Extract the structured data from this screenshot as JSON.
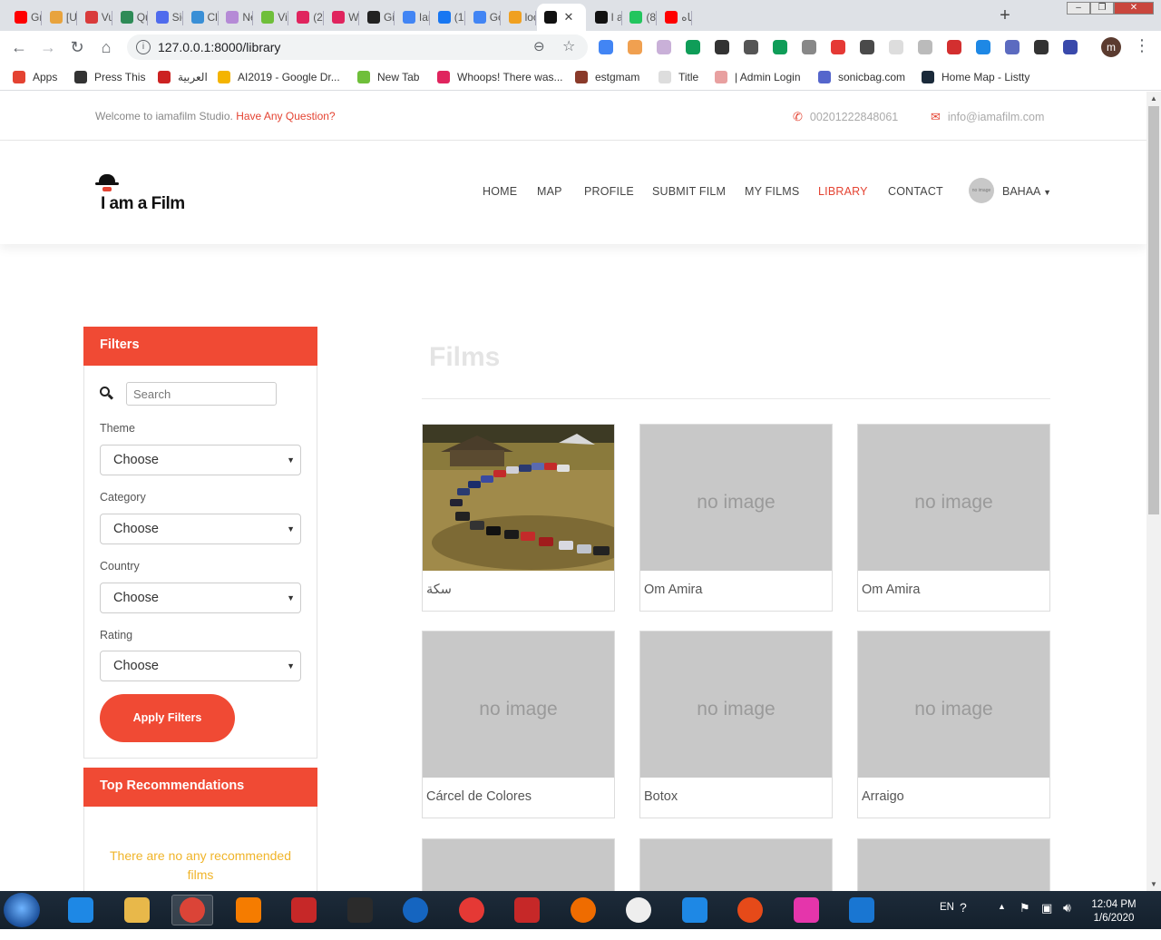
{
  "browser": {
    "tabs": [
      {
        "label": "Gra",
        "color": "#ff0000"
      },
      {
        "label": "[Uc",
        "color": "#e8a33d"
      },
      {
        "label": "Vuc",
        "color": "#d93b3b"
      },
      {
        "label": "Qu",
        "color": "#2e8b57"
      },
      {
        "label": "Sig",
        "color": "#4f6bed"
      },
      {
        "label": "Clo",
        "color": "#3a8fd6"
      },
      {
        "label": "Ne",
        "color": "#b58ad6"
      },
      {
        "label": "Vid",
        "color": "#6fbf3a"
      },
      {
        "label": "(2)",
        "color": "#e0245e"
      },
      {
        "label": "We",
        "color": "#e0245e"
      },
      {
        "label": "Git",
        "color": "#222222"
      },
      {
        "label": "Ian",
        "color": "#4285f4"
      },
      {
        "label": "(15",
        "color": "#1877f2"
      },
      {
        "label": "Go",
        "color": "#4285f4"
      },
      {
        "label": "loc",
        "color": "#f0a020"
      },
      {
        "label": "",
        "color": "#111111",
        "active": true
      },
      {
        "label": "I ar",
        "color": "#111111"
      },
      {
        "label": "(8)",
        "color": "#22c55e"
      },
      {
        "label": "ماه",
        "color": "#ff0000"
      }
    ],
    "url": "127.0.0.1:8000/library",
    "profile_initial": "m",
    "bookmarks": [
      {
        "label": "Apps",
        "color": "#e44332"
      },
      {
        "label": "Press This",
        "color": "#333333"
      },
      {
        "label": "العربية",
        "color": "#cc2222"
      },
      {
        "label": "AI2019 - Google Dr...",
        "color": "#f4b400"
      },
      {
        "label": "New Tab",
        "color": "#6fbf3a"
      },
      {
        "label": "Whoops! There was...",
        "color": "#e0245e"
      },
      {
        "label": "estgmam",
        "color": "#8a3a2a"
      },
      {
        "label": "Title",
        "color": "#dddddd"
      },
      {
        "label": "| Admin Login",
        "color": "#e8a0a0"
      },
      {
        "label": "sonicbag.com",
        "color": "#5566cc"
      },
      {
        "label": "Home Map - Listty",
        "color": "#1a2a3a"
      }
    ]
  },
  "topbar": {
    "welcome": "Welcome to iamafilm Studio.",
    "question": "Have Any Question?",
    "phone": "00201222848061",
    "email": "info@iamafilm.com"
  },
  "header": {
    "logo_text": "I am a Film",
    "nav": [
      "HOME",
      "MAP",
      "PROFILE",
      "SUBMIT FILM",
      "MY FILMS",
      "LIBRARY",
      "CONTACT"
    ],
    "active": "LIBRARY",
    "avatar_text": "no image",
    "user": "BAHAA"
  },
  "filters": {
    "title": "Filters",
    "search_placeholder": "Search",
    "fields": [
      {
        "label": "Theme",
        "value": "Choose"
      },
      {
        "label": "Category",
        "value": "Choose"
      },
      {
        "label": "Country",
        "value": "Choose"
      },
      {
        "label": "Rating",
        "value": "Choose"
      }
    ],
    "apply_label": "Apply Filters"
  },
  "recommendations": {
    "title": "Top Recommendations",
    "empty_text": "There are no any recommended films"
  },
  "films": {
    "title": "Films",
    "no_image": "no image",
    "items": [
      {
        "title": "سكة",
        "has_image": true
      },
      {
        "title": "Om Amira",
        "has_image": false
      },
      {
        "title": "Om Amira",
        "has_image": false
      },
      {
        "title": "Cárcel de Colores",
        "has_image": false
      },
      {
        "title": "Botox",
        "has_image": false
      },
      {
        "title": "Arraigo",
        "has_image": false
      }
    ]
  },
  "taskbar": {
    "language": "EN",
    "time": "12:04 PM",
    "date": "1/6/2020"
  },
  "colors": {
    "accent": "#f04a34",
    "link_red": "#e44332",
    "no_rec_text": "#f0b429",
    "placeholder_gray": "#c8c8c8"
  }
}
